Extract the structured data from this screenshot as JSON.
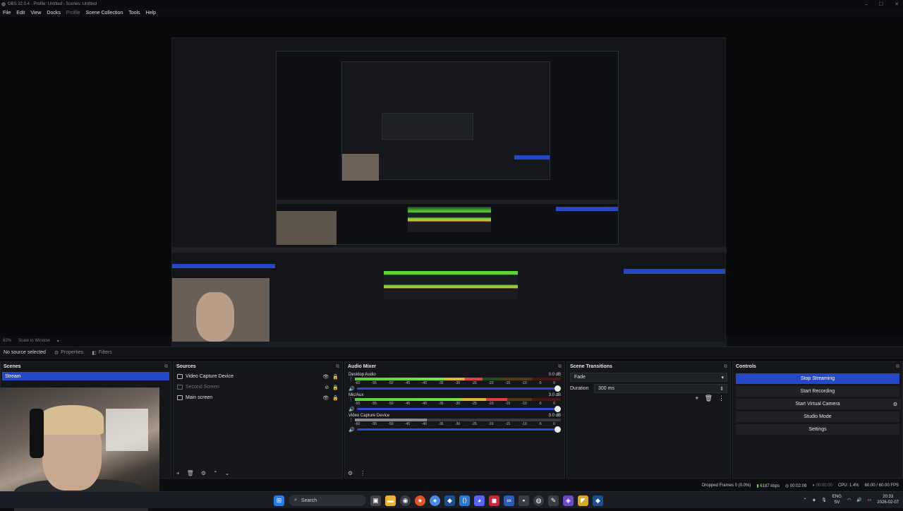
{
  "window": {
    "title": "OBS 32.0.4 - Profile: Untitled - Scenes: Untitled",
    "controls": [
      "–",
      "☐",
      "✕"
    ]
  },
  "menu": [
    {
      "label": "File",
      "dim": false
    },
    {
      "label": "Edit",
      "dim": false
    },
    {
      "label": "View",
      "dim": false
    },
    {
      "label": "Docks",
      "dim": false
    },
    {
      "label": "Profile",
      "dim": true
    },
    {
      "label": "Scene Collection",
      "dim": false
    },
    {
      "label": "Tools",
      "dim": false
    },
    {
      "label": "Help",
      "dim": false
    }
  ],
  "preview_status": {
    "zoom": "82%",
    "scale": "Scale to Window"
  },
  "toolbar": {
    "no_source": "No source selected",
    "properties": "Properties",
    "filters": "Filters"
  },
  "scenes": {
    "title": "Scenes",
    "items": [
      "Stream"
    ]
  },
  "sources": {
    "title": "Sources",
    "items": [
      {
        "label": "Video Capture Device",
        "dim": false
      },
      {
        "label": "Second Screen",
        "dim": true
      },
      {
        "label": "Main screen",
        "dim": false
      }
    ]
  },
  "mixer": {
    "title": "Audio Mixer",
    "ticks": [
      "-60",
      "-55",
      "-50",
      "-45",
      "-40",
      "-35",
      "-30",
      "-25",
      "-20",
      "-15",
      "-10",
      "-5",
      "0"
    ],
    "channels": [
      {
        "name": "Desktop Audio",
        "db": "0.0 dB",
        "level_pct": 0.62,
        "active": true
      },
      {
        "name": "Mic/Aux",
        "db": "3.0 dB",
        "level_pct": 0.74,
        "active": true
      },
      {
        "name": "Video Capture Device",
        "db": "0.0 dB",
        "level_pct": 0.35,
        "active": false
      }
    ]
  },
  "transitions": {
    "title": "Scene Transitions",
    "type": "Fade",
    "duration_label": "Duration",
    "duration": "300 ms"
  },
  "controls": {
    "title": "Controls",
    "buttons": [
      "Stop Streaming",
      "Start Recording",
      "Start Virtual Camera",
      "Studio Mode",
      "Settings"
    ]
  },
  "status": {
    "dropped": "Dropped Frames 0 (0.0%)",
    "kbps": "6187 kbps",
    "stream_time": "00:02:09",
    "rec_time": "00:00:00",
    "cpu": "CPU: 1.4%",
    "fps": "60.00 / 60.00 FPS"
  },
  "taskbar": {
    "search": "Search",
    "lang": "ENG",
    "lang2": "SV",
    "time": "20:33",
    "date": "2026-02-07"
  },
  "colors": {
    "accent": "#2448c6",
    "meter_green": "#5cd23b",
    "meter_yellow": "#e0b63a",
    "meter_red": "#e04040"
  }
}
